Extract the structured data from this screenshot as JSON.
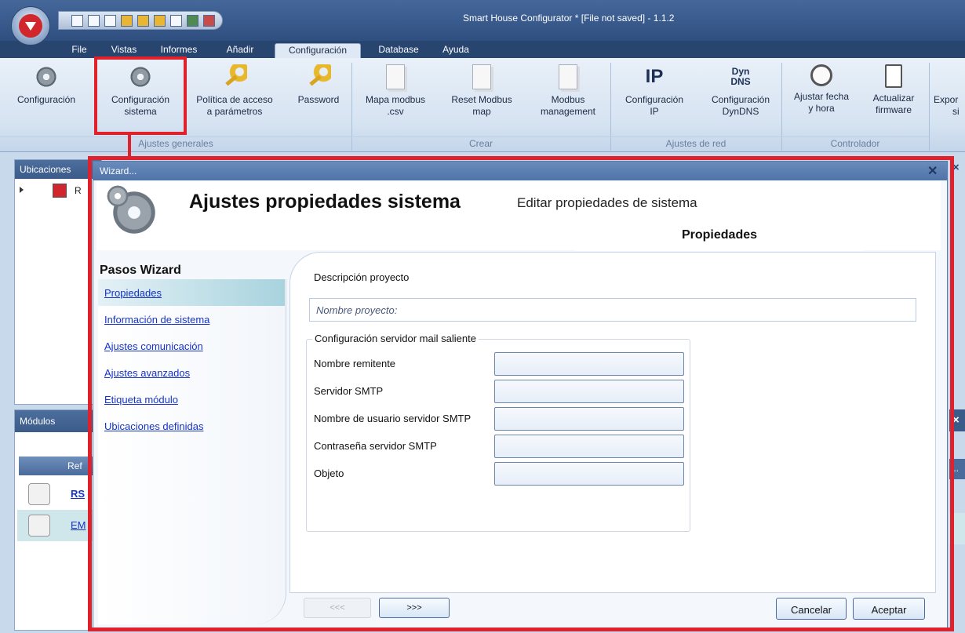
{
  "window": {
    "title": "Smart House Configurator * [File not saved] - 1.1.2"
  },
  "ribbon_tabs": [
    "File",
    "Vistas",
    "Informes",
    "Añadir",
    "Configuración",
    "Database",
    "Ayuda"
  ],
  "ribbon_buttons": [
    {
      "label1": "Configuración",
      "label2": "",
      "icon": "gear-icon"
    },
    {
      "label1": "Configuración",
      "label2": "sistema",
      "icon": "gear-icon"
    },
    {
      "label1": "Política de acceso",
      "label2": "a parámetros",
      "icon": "key-icon"
    },
    {
      "label1": "Password",
      "label2": "",
      "icon": "key-icon"
    },
    {
      "label1": "Mapa modbus",
      "label2": ".csv",
      "icon": "document-icon"
    },
    {
      "label1": "Reset Modbus",
      "label2": "map",
      "icon": "document-icon"
    },
    {
      "label1": "Modbus",
      "label2": "management",
      "icon": "document-icon"
    },
    {
      "label1": "Configuración",
      "label2": "IP",
      "icon": "ip-icon"
    },
    {
      "label1": "Configuración",
      "label2": "DynDNS",
      "icon": "dyndns-icon"
    },
    {
      "label1": "Ajustar fecha",
      "label2": "y hora",
      "icon": "clock-icon"
    },
    {
      "label1": "Actualizar",
      "label2": "firmware",
      "icon": "firmware-icon"
    },
    {
      "label1": "Expor",
      "label2": "si",
      "icon": "export-icon"
    }
  ],
  "ribbon_groups": [
    "Ajustes generales",
    "Crear",
    "Ajustes de red",
    "Controlador"
  ],
  "icon_text": {
    "ip": "IP",
    "dyn": "Dyn",
    "dns": "DNS"
  },
  "panes": {
    "locations_title": "Ubicaciones",
    "location_item": "R",
    "modules_title": "Módulos",
    "modules_col": "Ref",
    "modules_rows": [
      "RS",
      "EM"
    ]
  },
  "wizard": {
    "title": "Wizard...",
    "heading": "Ajustes propiedades sistema",
    "subheading": "Editar propiedades de sistema",
    "tab": "Propiedades",
    "steps_title": "Pasos Wizard",
    "steps": [
      "Propiedades",
      "Información de sistema",
      "Ajustes comunicación",
      "Ajustes avanzados",
      "Etiqueta módulo",
      "Ubicaciones definidas"
    ],
    "description_label": "Descripción proyecto",
    "project_name_placeholder": "Nombre proyecto:",
    "mail_group_title": "Configuración servidor mail saliente",
    "mail_fields": [
      "Nombre remitente",
      "Servidor SMTP",
      "Nombre de usuario servidor SMTP",
      "Contraseña servidor SMTP",
      "Objeto"
    ],
    "prev_label": "<<<",
    "next_label": ">>>",
    "cancel_label": "Cancelar",
    "accept_label": "Aceptar"
  },
  "colors": {
    "highlight": "#e0202a",
    "title_bar": "#2f4f80",
    "link": "#1633c7"
  }
}
